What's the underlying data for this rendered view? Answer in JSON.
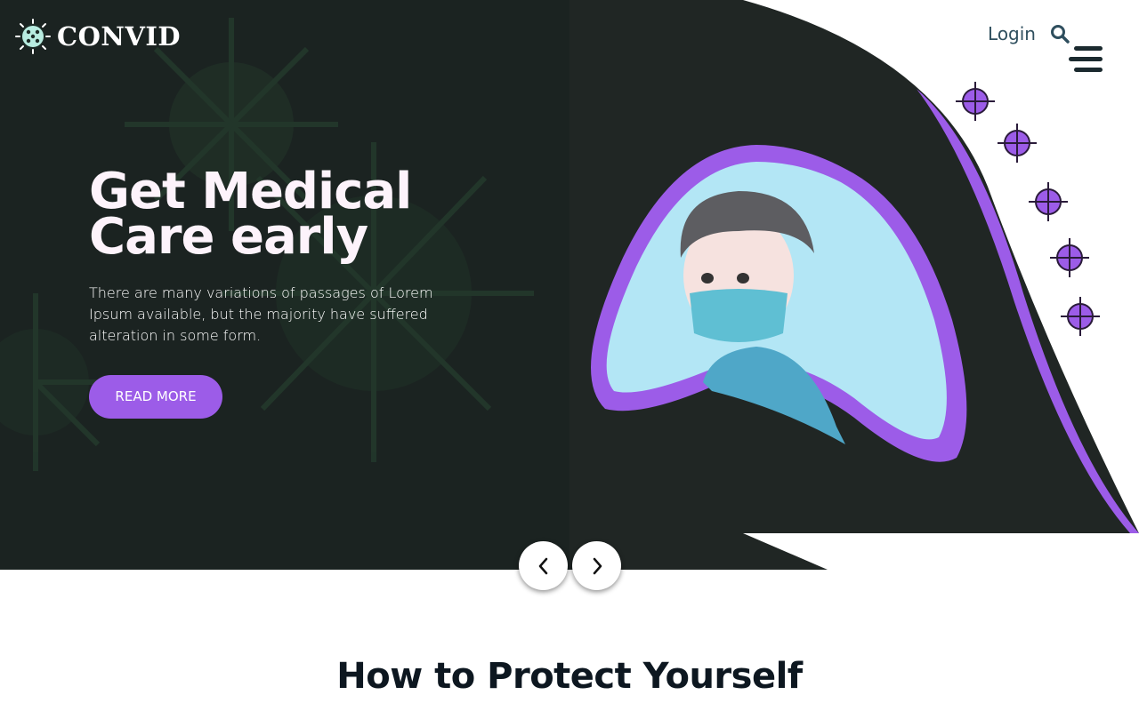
{
  "brand": {
    "name": "CONVID",
    "logo_icon": "virus-icon"
  },
  "nav": {
    "login_label": "Login",
    "search_icon": "search-icon",
    "menu_icon": "hamburger-icon"
  },
  "hero": {
    "title_line1": "Get Medical",
    "title_line2": "Care early",
    "description": "There are many variations of passages of Lorem Ipsum available, but the majority have suffered alteration in some form.",
    "cta_label": "READ MORE"
  },
  "slider": {
    "prev_icon": "chevron-left-icon",
    "next_icon": "chevron-right-icon"
  },
  "section": {
    "title": "How to Protect Yourself"
  },
  "colors": {
    "accent": "#9c5ce8",
    "hero_bg": "#1c2422",
    "title_dark": "#0d1720",
    "nav_text": "#2f4f5e"
  }
}
